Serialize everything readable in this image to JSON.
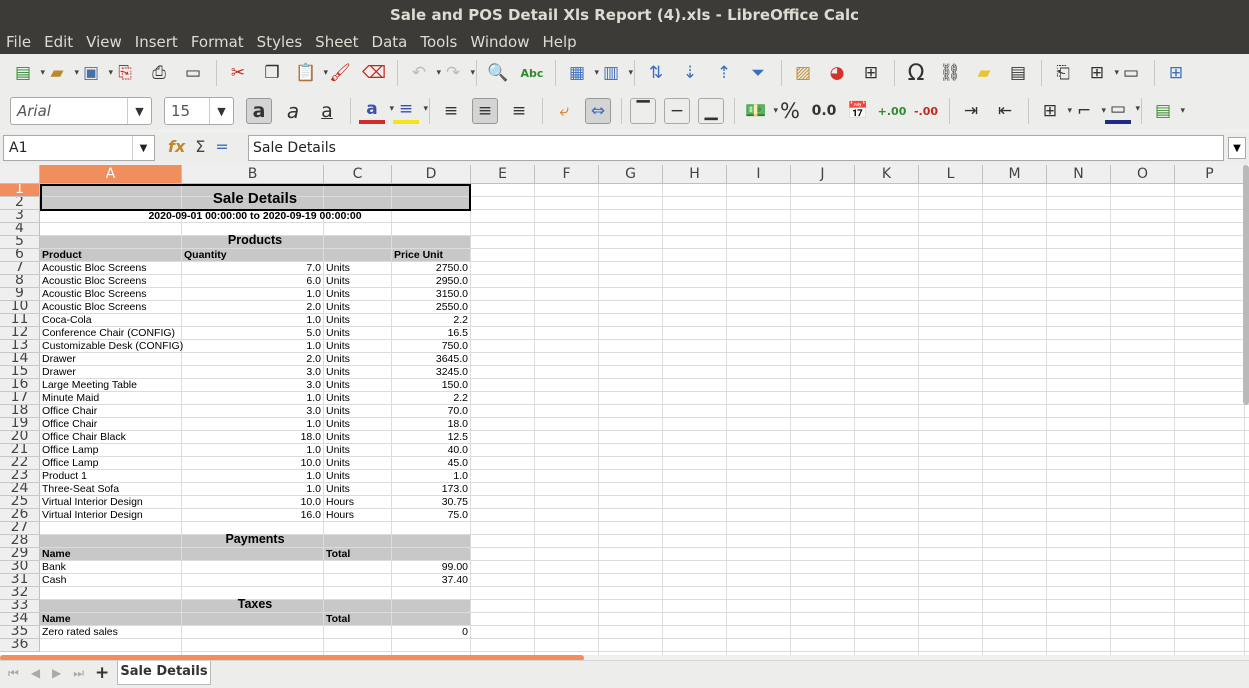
{
  "window": {
    "title": "Sale and POS Detail Xls Report (4).xls - LibreOffice Calc"
  },
  "menu": [
    "File",
    "Edit",
    "View",
    "Insert",
    "Format",
    "Styles",
    "Sheet",
    "Data",
    "Tools",
    "Window",
    "Help"
  ],
  "font": {
    "name": "Arial",
    "size": "15"
  },
  "formula": {
    "cell_ref": "A1",
    "content": "Sale Details"
  },
  "columns": [
    "A",
    "B",
    "C",
    "D",
    "E",
    "F",
    "G",
    "H",
    "I",
    "J",
    "K",
    "L",
    "M",
    "N",
    "O",
    "P"
  ],
  "rows": [
    "1",
    "2",
    "3",
    "4",
    "5",
    "6",
    "7",
    "8",
    "9",
    "10",
    "11",
    "12",
    "13",
    "14",
    "15",
    "16",
    "17",
    "18",
    "19",
    "20",
    "21",
    "22",
    "23",
    "24",
    "25",
    "26",
    "27",
    "28",
    "29",
    "30",
    "31",
    "32",
    "33",
    "34",
    "35",
    "36"
  ],
  "report": {
    "title": "Sale Details",
    "date_range": "2020-09-01 00:00:00 to 2020-09-19 00:00:00",
    "products_section": "Products",
    "product_headers": {
      "product": "Product",
      "quantity": "Quantity",
      "price_unit": "Price Unit"
    },
    "products": [
      {
        "name": "Acoustic Bloc Screens",
        "qty": "7.0",
        "uom": "Units",
        "price": "2750.0"
      },
      {
        "name": "Acoustic Bloc Screens",
        "qty": "6.0",
        "uom": "Units",
        "price": "2950.0"
      },
      {
        "name": "Acoustic Bloc Screens",
        "qty": "1.0",
        "uom": "Units",
        "price": "3150.0"
      },
      {
        "name": "Acoustic Bloc Screens",
        "qty": "2.0",
        "uom": "Units",
        "price": "2550.0"
      },
      {
        "name": "Coca-Cola",
        "qty": "1.0",
        "uom": "Units",
        "price": "2.2"
      },
      {
        "name": "Conference Chair (CONFIG)",
        "qty": "5.0",
        "uom": "Units",
        "price": "16.5"
      },
      {
        "name": "Customizable Desk (CONFIG)",
        "qty": "1.0",
        "uom": "Units",
        "price": "750.0"
      },
      {
        "name": "Drawer",
        "qty": "2.0",
        "uom": "Units",
        "price": "3645.0"
      },
      {
        "name": "Drawer",
        "qty": "3.0",
        "uom": "Units",
        "price": "3245.0"
      },
      {
        "name": "Large Meeting Table",
        "qty": "3.0",
        "uom": "Units",
        "price": "150.0"
      },
      {
        "name": "Minute Maid",
        "qty": "1.0",
        "uom": "Units",
        "price": "2.2"
      },
      {
        "name": "Office Chair",
        "qty": "3.0",
        "uom": "Units",
        "price": "70.0"
      },
      {
        "name": "Office Chair",
        "qty": "1.0",
        "uom": "Units",
        "price": "18.0"
      },
      {
        "name": "Office Chair Black",
        "qty": "18.0",
        "uom": "Units",
        "price": "12.5"
      },
      {
        "name": "Office Lamp",
        "qty": "1.0",
        "uom": "Units",
        "price": "40.0"
      },
      {
        "name": "Office Lamp",
        "qty": "10.0",
        "uom": "Units",
        "price": "45.0"
      },
      {
        "name": "Product 1",
        "qty": "1.0",
        "uom": "Units",
        "price": "1.0"
      },
      {
        "name": "Three-Seat Sofa",
        "qty": "1.0",
        "uom": "Units",
        "price": "173.0"
      },
      {
        "name": "Virtual Interior Design",
        "qty": "10.0",
        "uom": "Hours",
        "price": "30.75"
      },
      {
        "name": "Virtual Interior Design",
        "qty": "16.0",
        "uom": "Hours",
        "price": "75.0"
      }
    ],
    "payments_section": "Payments",
    "payment_headers": {
      "name": "Name",
      "total": "Total"
    },
    "payments": [
      {
        "name": "Bank",
        "total": "99.00"
      },
      {
        "name": "Cash",
        "total": "37.40"
      }
    ],
    "taxes_section": "Taxes",
    "tax_headers": {
      "name": "Name",
      "total": "Total"
    },
    "taxes": [
      {
        "name": "Zero rated sales",
        "total": "0"
      }
    ]
  },
  "sheet_tab": "Sale Details",
  "colors": {
    "accent": "#f08e5e",
    "titlebar": "#3c3b37",
    "band": "#c8c8c8"
  }
}
